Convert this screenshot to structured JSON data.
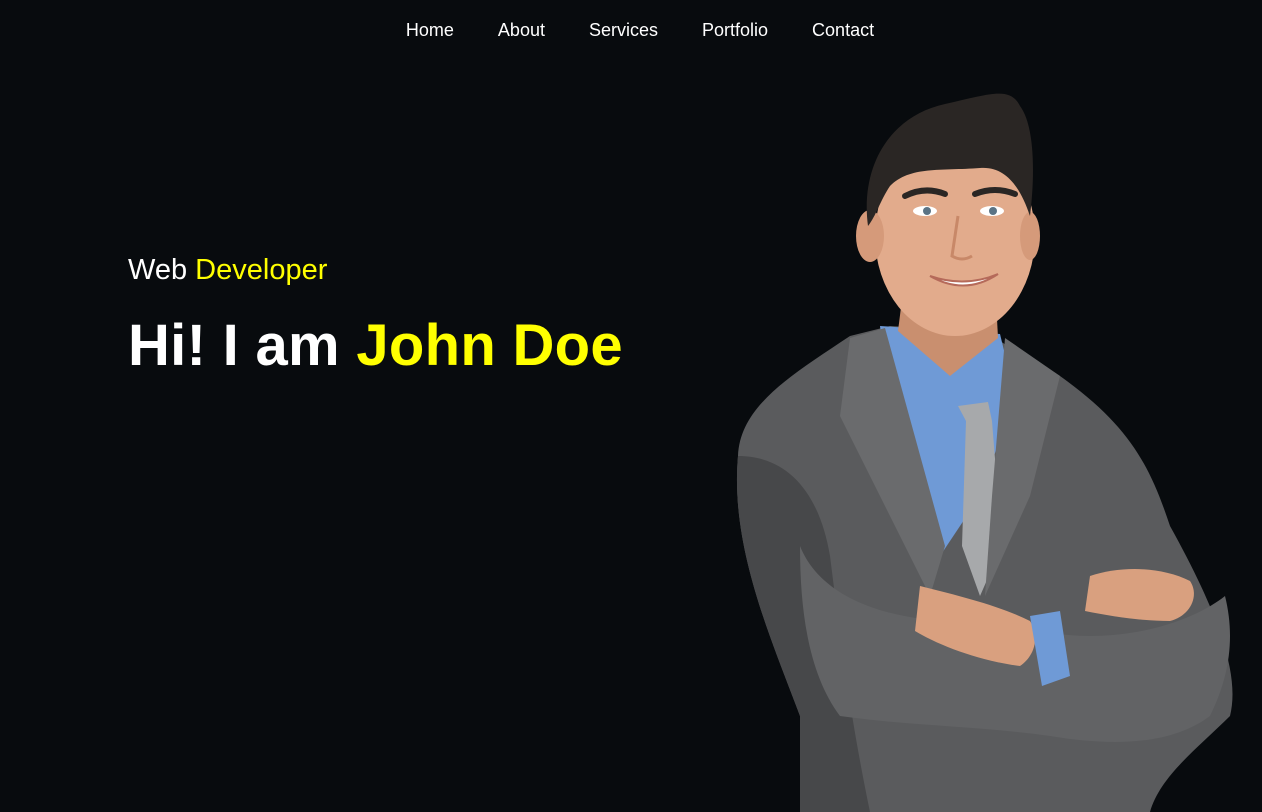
{
  "nav": {
    "items": [
      {
        "label": "Home"
      },
      {
        "label": "About"
      },
      {
        "label": "Services"
      },
      {
        "label": "Portfolio"
      },
      {
        "label": "Contact"
      }
    ]
  },
  "hero": {
    "subtitle_prefix": "Web",
    "subtitle_highlight": "Developer",
    "headline_prefix": "Hi! I am",
    "headline_highlight": "John Doe"
  },
  "colors": {
    "background": "#080b0e",
    "text": "#ffffff",
    "accent": "#ffff00"
  }
}
